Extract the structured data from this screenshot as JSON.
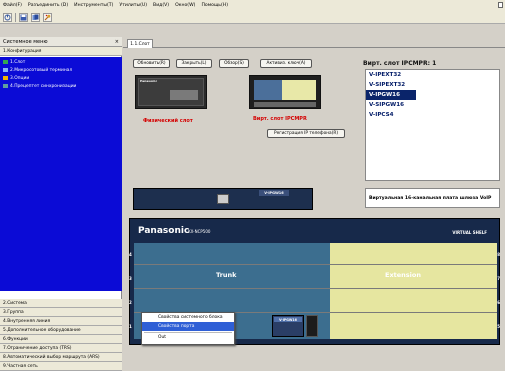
{
  "menu": [
    "Файл(F)",
    "Разъединить (D)",
    "Инструменты(T)",
    "Утилиты(U)",
    "Вид(V)",
    "Окно(W)",
    "Помощь(H)"
  ],
  "sidebar": {
    "title": "Системное меню",
    "close": "×",
    "section": "1.Конфигурация",
    "tree": [
      {
        "label": "1.Слот",
        "icon_color": "#34a853"
      },
      {
        "label": "2.Микросотовый терминал",
        "icon_color": "#8ab4f8"
      },
      {
        "label": "3.Опции",
        "icon_color": "#f4b400"
      },
      {
        "label": "4.Прецептет синхронизации",
        "icon_color": "#5f9ea0"
      }
    ],
    "bottom": [
      "2.Система",
      "3.Группа",
      "4.Внутренняя линия",
      "5.Дополнительное оборудование",
      "6.Функции",
      "7.Ограничение доступа (TRS)",
      "8.Автоматический выбор маршрута (ARS)",
      "9.Частная сеть"
    ]
  },
  "tab": {
    "label": "1.1.Слот"
  },
  "buttons": {
    "refresh": "Обновить(R)",
    "close": "Закрыть(L)",
    "browse": "Обзор(S)",
    "activate": "Активиз. ключ(A)",
    "register_ip": "Регистрация IP телефона(R)"
  },
  "virtual_slot": {
    "label": "Вирт. слот IPCMPR:",
    "count": "1",
    "cards": [
      "V-IPEXT32",
      "V-SIPEXT32",
      "V-IPGW16",
      "V-SIPGW16",
      "V-IPCS4"
    ],
    "selected": 2
  },
  "captions": {
    "physical": "Физический слот",
    "virtual": "Вирт. слот IPCMPR"
  },
  "card_preview": {
    "badge": "V-IPGW16",
    "description": "Виртуальная 16-канальная плата шлюза VoIP"
  },
  "shelf": {
    "brand": "Panasonic",
    "model": "KX-NCP500",
    "title": "VIRTUAL SHELF",
    "row_numbers_left": [
      "4",
      "3",
      "2",
      "1"
    ],
    "row_numbers_right": [
      "8",
      "7",
      "6",
      "5"
    ],
    "trunk_label": "Trunk",
    "extension_label": "Extension",
    "installed_card": "V-IPGW16",
    "colors": {
      "trunk": "#3c6e8f",
      "extension": "#e6e6a0"
    }
  },
  "context_menu": {
    "items": [
      "Свойства системного блока",
      "Свойства порта",
      "Out"
    ],
    "highlighted": 1
  }
}
